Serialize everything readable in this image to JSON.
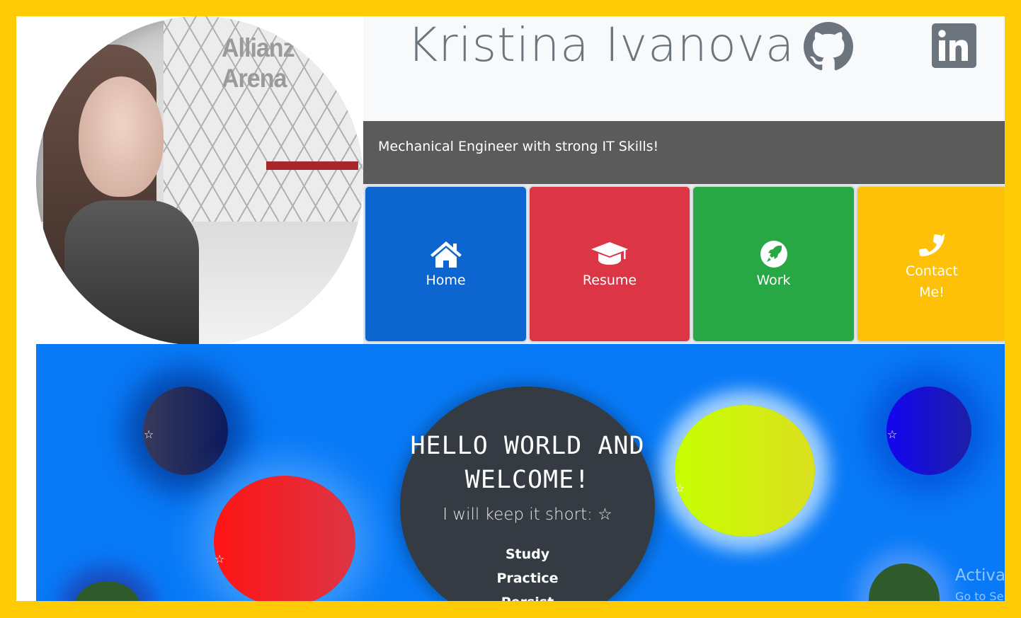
{
  "header": {
    "name": "Kristina Ivanova",
    "tagline": "Mechanical Engineer with strong IT Skills!",
    "photo_sign_text": "Allianz Arena",
    "social": [
      {
        "id": "github",
        "icon": "github-icon"
      },
      {
        "id": "linkedin",
        "icon": "linkedin-icon",
        "text": "in"
      }
    ]
  },
  "nav": {
    "tiles": [
      {
        "label": "Home",
        "icon": "home-icon",
        "color": "#0d66d0"
      },
      {
        "label": "Resume",
        "icon": "graduation-cap-icon",
        "color": "#dc3545"
      },
      {
        "label": "Work",
        "icon": "space-icon",
        "color": "#28a745"
      },
      {
        "label_line1": "Contact",
        "label_line2": "Me!",
        "icon": "phone-icon",
        "color": "#ffc107"
      }
    ]
  },
  "hero": {
    "title_line1": "HELLO WORLD AND",
    "title_line2": "WELCOME!",
    "subtitle": "I will keep it short: ☆",
    "list": [
      "Study",
      "Practice",
      "Persist"
    ],
    "star": "☆",
    "background": "#087af7"
  },
  "overlay": {
    "watermark_line1": "Activat",
    "watermark_line2": "Go to Se"
  },
  "colors": {
    "frame": "#ffcb05",
    "tagline_bar": "#5c5b5c",
    "header_bg": "#f8f9fa"
  }
}
